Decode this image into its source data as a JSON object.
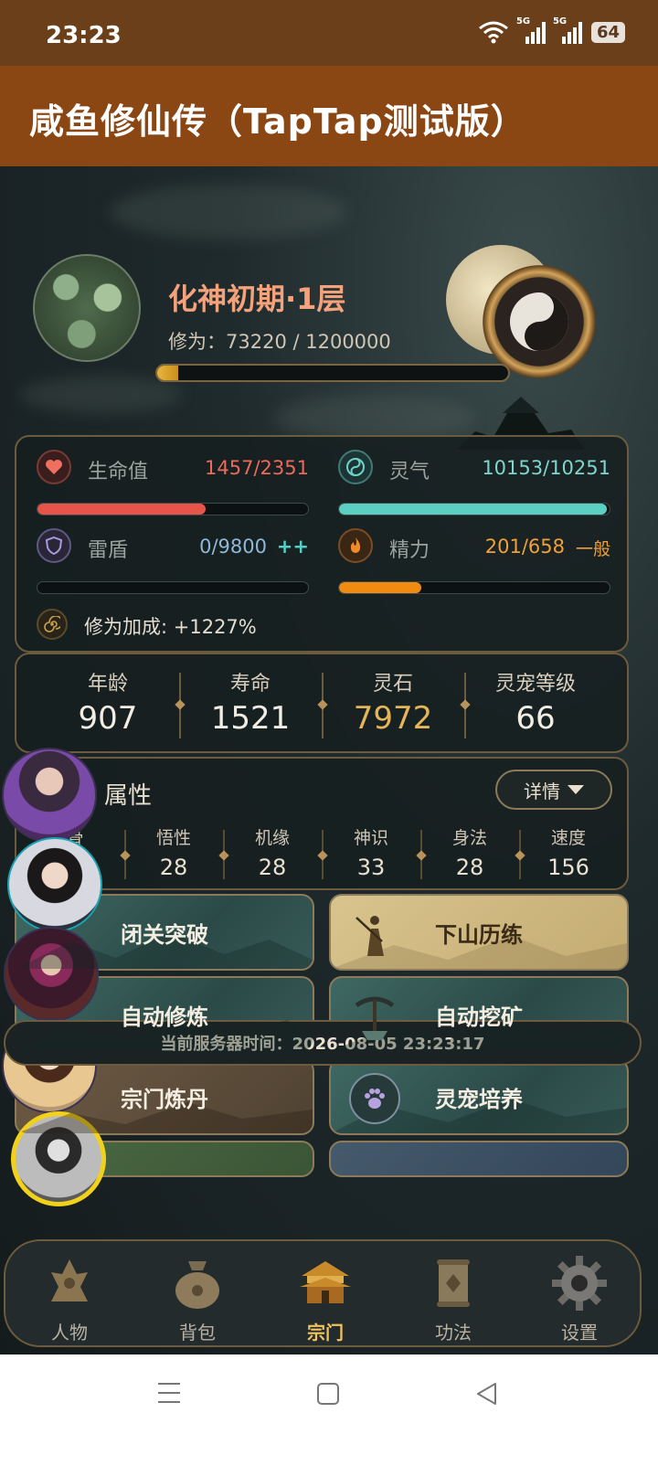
{
  "status_bar": {
    "time": "23:23",
    "battery": "64",
    "sim1": "5G",
    "sim2": "5G"
  },
  "app": {
    "title": "咸鱼修仙传（TapTap测试版）"
  },
  "player": {
    "realm": "化神初期·1层",
    "cultivation_label": "修为：",
    "cultivation_value": "73220 / 1200000",
    "cultivation_progress": 0.061
  },
  "stats": {
    "hp": {
      "label": "生命值",
      "value": "1457/2351",
      "progress": 0.62,
      "icon": "heart-icon",
      "color": "#e8544a"
    },
    "spirit": {
      "label": "灵气",
      "value": "10153/10251",
      "progress": 0.99,
      "icon": "swirl-icon",
      "color": "#56c3b9"
    },
    "shield": {
      "label": "雷盾",
      "value": "0/9800",
      "suffix": "++",
      "progress": 0.0,
      "icon": "shield-icon",
      "color": "#7fb2d6"
    },
    "energy": {
      "label": "精力",
      "value": "201/658",
      "suffix": "一般",
      "progress": 0.305,
      "icon": "flame-icon",
      "color": "#f0a03a"
    },
    "bonus": {
      "label": "修为加成: +1227%",
      "icon": "spiral-icon"
    }
  },
  "info": [
    {
      "label": "年龄",
      "value": "907"
    },
    {
      "label": "寿命",
      "value": "1521"
    },
    {
      "label": "灵石",
      "value": "7972"
    },
    {
      "label": "灵宠等级",
      "value": "66"
    }
  ],
  "attributes": {
    "title": "属性",
    "detail_button": "详情",
    "items": [
      {
        "label": "骨",
        "value": ""
      },
      {
        "label": "悟性",
        "value": "28"
      },
      {
        "label": "机缘",
        "value": "28"
      },
      {
        "label": "神识",
        "value": "33"
      },
      {
        "label": "身法",
        "value": "28"
      },
      {
        "label": "速度",
        "value": "156"
      }
    ]
  },
  "actions": [
    {
      "label": "闭关突破"
    },
    {
      "label": "下山历练"
    },
    {
      "label": "自动修炼"
    },
    {
      "label": "自动挖矿"
    },
    {
      "label": "宗门炼丹"
    },
    {
      "label": "灵宠培养"
    }
  ],
  "server_time": "当前服务器时间：2026-08-05 23:23:17",
  "nav": [
    {
      "label": "人物",
      "icon": "character-icon"
    },
    {
      "label": "背包",
      "icon": "bag-icon"
    },
    {
      "label": "宗门",
      "icon": "sect-icon",
      "active": true
    },
    {
      "label": "功法",
      "icon": "scroll-icon"
    },
    {
      "label": "设置",
      "icon": "gear-icon"
    }
  ]
}
